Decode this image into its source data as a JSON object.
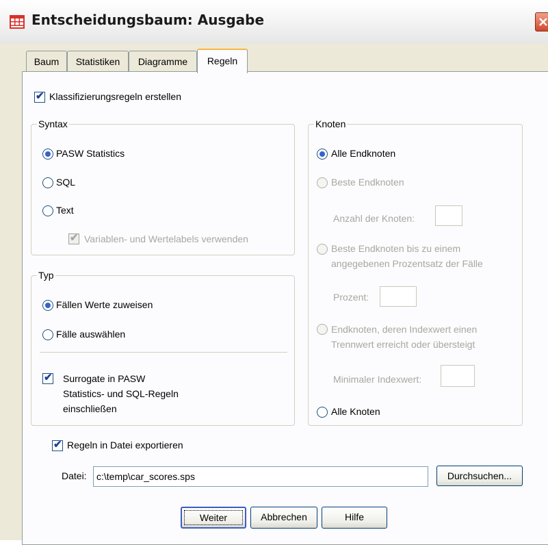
{
  "window": {
    "title": "Entscheidungsbaum: Ausgabe"
  },
  "tabs": [
    {
      "label": "Baum"
    },
    {
      "label": "Statistiken"
    },
    {
      "label": "Diagramme"
    },
    {
      "label": "Regeln"
    }
  ],
  "active_tab": "Regeln",
  "classification": {
    "label": "Klassifizierungsregeln erstellen",
    "checked": true
  },
  "syntax": {
    "legend": "Syntax",
    "options": [
      {
        "label": "PASW Statistics",
        "selected": true
      },
      {
        "label": "SQL",
        "selected": false
      },
      {
        "label": "Text",
        "selected": false
      }
    ],
    "labels_option": {
      "label": "Variablen- und Wertelabels verwenden",
      "checked": true,
      "enabled": false
    }
  },
  "typ": {
    "legend": "Typ",
    "options": [
      {
        "label": "Fällen Werte zuweisen",
        "selected": true
      },
      {
        "label": "Fälle auswählen",
        "selected": false
      }
    ],
    "surrogate": {
      "line1": "Surrogate in PASW",
      "line2": "Statistics- und SQL-Regeln",
      "line3": "einschließen",
      "checked": true
    }
  },
  "knoten": {
    "legend": "Knoten",
    "all_end": {
      "label": "Alle Endknoten",
      "selected": true
    },
    "best_end": {
      "label": "Beste Endknoten",
      "count_label": "Anzahl der Knoten:",
      "count_value": ""
    },
    "best_percent": {
      "line1": "Beste Endknoten bis zu einem",
      "line2": "angegebenen Prozentsatz der Fälle",
      "percent_label": "Prozent:",
      "percent_value": ""
    },
    "index": {
      "line1": "Endknoten, deren Indexwert einen",
      "line2": "Trennwert erreicht oder übersteigt",
      "min_label": "Minimaler Indexwert:",
      "min_value": ""
    },
    "all_nodes": {
      "label": "Alle Knoten",
      "selected": false
    }
  },
  "export": {
    "label": "Regeln in Datei exportieren",
    "checked": true,
    "file_label": "Datei:",
    "file_value": "c:\\temp\\car_scores.sps",
    "browse_label": "Durchsuchen..."
  },
  "buttons": {
    "continue": "Weiter",
    "cancel": "Abbrechen",
    "help": "Hilfe"
  },
  "colors": {
    "accent": "#3563c9",
    "tab_highlight": "#f6b542",
    "close": "#d0462b"
  }
}
